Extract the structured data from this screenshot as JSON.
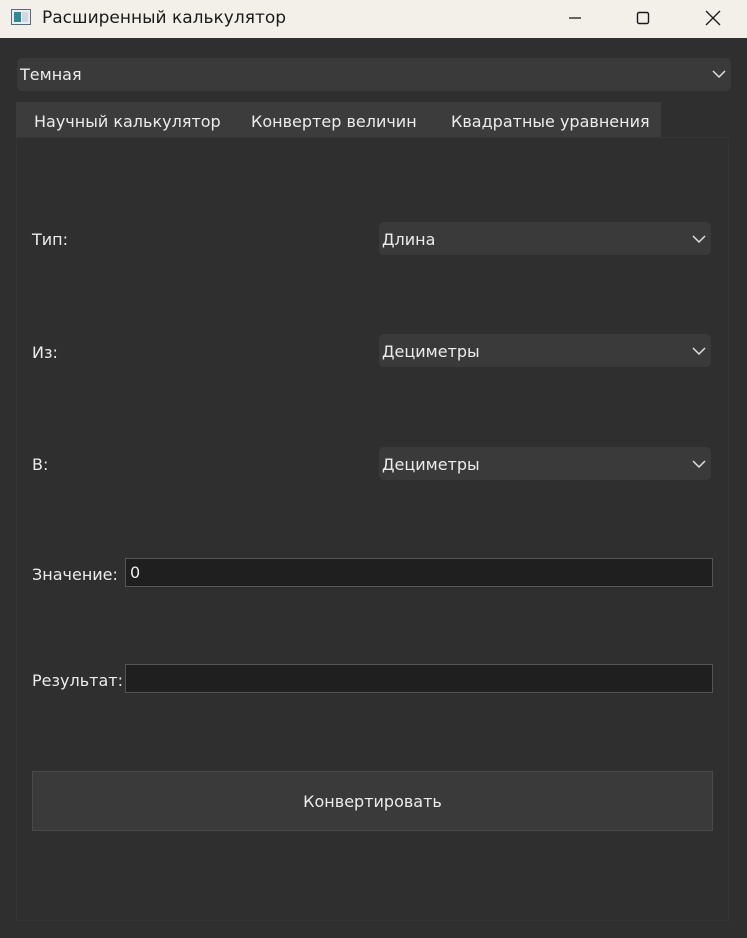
{
  "window": {
    "title": "Расширенный калькулятор",
    "icon": "app-window-icon",
    "controls": [
      "minimize-icon",
      "maximize-icon",
      "close-icon"
    ]
  },
  "theme": {
    "selected": "Темная"
  },
  "tabs": [
    {
      "label": "Научный калькулятор"
    },
    {
      "label": "Конвертер величин"
    },
    {
      "label": "Квадратные уравнения"
    }
  ],
  "converter": {
    "type_label": "Тип:",
    "type_value": "Длина",
    "from_label": "Из:",
    "from_value": "Дециметры",
    "to_label": "В:",
    "to_value": "Дециметры",
    "value_label": "Значение:",
    "value_input": "0",
    "result_label": "Результат:",
    "result_value": "",
    "convert_button": "Конвертировать"
  },
  "colors": {
    "background": "#2f2f2f",
    "titlebar": "#f3f0ea",
    "control": "#3a3a3a",
    "input": "#1f1f1f",
    "text": "#ececec"
  }
}
